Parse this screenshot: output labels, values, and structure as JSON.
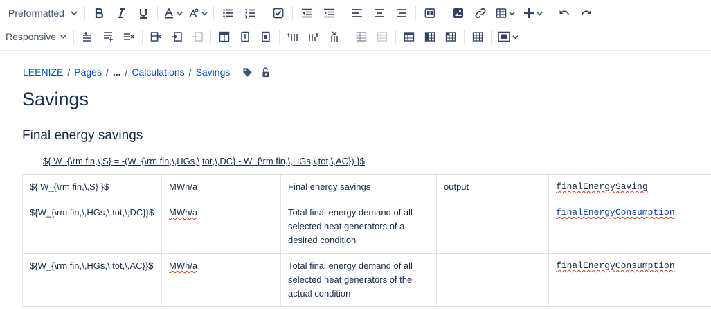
{
  "toolbar": {
    "text_style": "Preformatted",
    "layout_mode": "Responsive"
  },
  "breadcrumb": {
    "items": [
      "LEENIZE",
      "Pages",
      "...",
      "Calculations",
      "Savings"
    ],
    "separator": "/"
  },
  "page": {
    "title": "Savings",
    "section_title": "Final energy savings",
    "formula": "${ W_{\\rm fin,\\,S} = -(W_{\\rm fin,\\,HGs,\\,tot,\\,DC} - W_{\\rm fin,\\,HGs,\\,tot,\\,AC}) }$"
  },
  "table": {
    "rows": [
      {
        "symbol": "${ W_{\\rm fin,\\,S} }$",
        "unit": "MWh/a",
        "description": "Final energy savings",
        "type": "output",
        "variable": "finalEnergySaving"
      },
      {
        "symbol": "${W_{\\rm fin,\\,HGs,\\,tot,\\,DC}}$",
        "unit": "MWh/a",
        "description": "Total final energy demand of all selected heat generators of a desired condition",
        "type": "",
        "variable": "finalEnergyConsumption"
      },
      {
        "symbol": "${W_{\\rm fin,\\,HGs,\\,tot,\\,AC}}$",
        "unit": "MWh/a",
        "description": "Total final energy demand of all selected heat generators of the actual condition",
        "type": "",
        "variable": "finalEnergyConsumption"
      }
    ]
  },
  "colors": {
    "link": "#0052cc",
    "text": "#172b4d",
    "border": "#dfe1e6",
    "spellcheck": "#de350b"
  }
}
